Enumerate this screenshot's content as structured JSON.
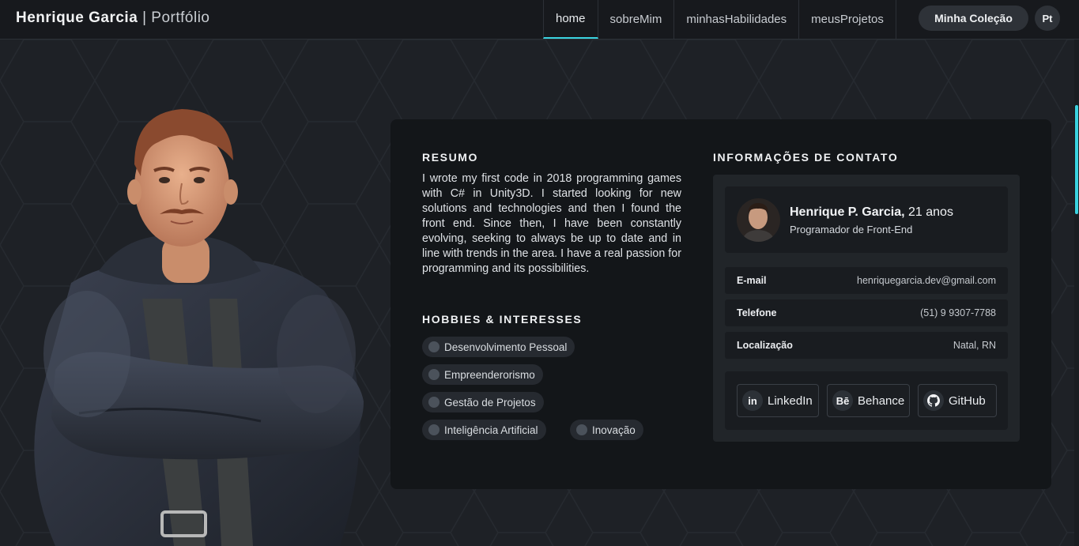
{
  "nav": {
    "brand_name": "Henrique Garcia",
    "brand_sep": "|",
    "brand_sub": "Portfólio",
    "tabs": [
      {
        "label": "home"
      },
      {
        "label": "sobreMim"
      },
      {
        "label": "minhasHabilidades"
      },
      {
        "label": "meusProjetos"
      }
    ],
    "collection_label": "Minha Coleção",
    "lang_label": "Pt"
  },
  "summary": {
    "title": "RESUMO",
    "text": "I wrote my first code in 2018 programming games with C# in Unity3D. I started looking for new solutions and technologies and then I found the front end. Since then, I have been constantly evolving, seeking to always be up to date and in line with trends in the area. I have a real passion for programming and its possibilities."
  },
  "hobbies": {
    "title": "HOBBIES & INTERESSES",
    "items": [
      "Desenvolvimento Pessoal",
      "Empreenderorismo",
      "Gestão de Projetos",
      "Inteligência Artificial",
      "Inovação"
    ]
  },
  "contact": {
    "title": "INFORMAÇÕES DE CONTATO",
    "name": "Henrique P. Garcia,",
    "age": "21 anos",
    "role": "Programador de Front-End",
    "rows": [
      {
        "key": "E-mail",
        "value": "henriquegarcia.dev@gmail.com"
      },
      {
        "key": "Telefone",
        "value": "(51) 9 9307-7788"
      },
      {
        "key": "Localização",
        "value": "Natal, RN"
      }
    ],
    "socials": [
      {
        "label": "LinkedIn",
        "icon": "in"
      },
      {
        "label": "Behance",
        "icon": "Bē"
      },
      {
        "label": "GitHub",
        "icon": "github-icon"
      }
    ]
  },
  "colors": {
    "accent": "#3ad3e0",
    "background": "#1e2126",
    "card": "#131619"
  }
}
